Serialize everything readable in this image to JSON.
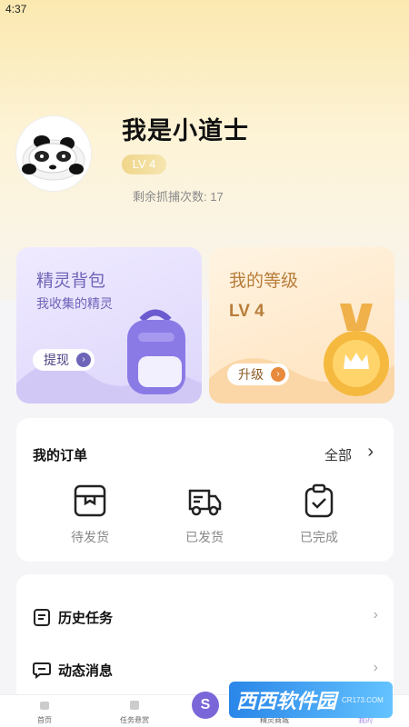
{
  "status_bar": {
    "time": "4:37"
  },
  "profile": {
    "name": "我是小道士",
    "level": "LV 4",
    "catch_label": "剩余抓捕次数:",
    "catch_count": "17"
  },
  "cards": {
    "backpack": {
      "title": "精灵背包",
      "subtitle": "我收集的精灵",
      "button": "提现"
    },
    "level": {
      "title": "我的等级",
      "value": "LV 4",
      "button": "升级"
    }
  },
  "orders": {
    "title": "我的订单",
    "all_label": "全部",
    "items": [
      {
        "label": "待发货",
        "icon": "package-icon"
      },
      {
        "label": "已发货",
        "icon": "truck-icon"
      },
      {
        "label": "已完成",
        "icon": "clipboard-check-icon"
      }
    ]
  },
  "menu": {
    "items": [
      {
        "label": "历史任务",
        "icon": "task-list-icon"
      },
      {
        "label": "动态消息",
        "icon": "message-icon"
      }
    ]
  },
  "tabbar": {
    "tabs": [
      {
        "label": "首页"
      },
      {
        "label": "任务悬赏"
      },
      {
        "label": "S"
      },
      {
        "label": "精灵商城"
      },
      {
        "label": "我的"
      }
    ]
  },
  "watermark": {
    "text": "西西软件园",
    "sub": "CR173.COM"
  },
  "colors": {
    "accent": "#7b66d9",
    "gold": "#e88a3c",
    "purple": "#6e64b8"
  }
}
